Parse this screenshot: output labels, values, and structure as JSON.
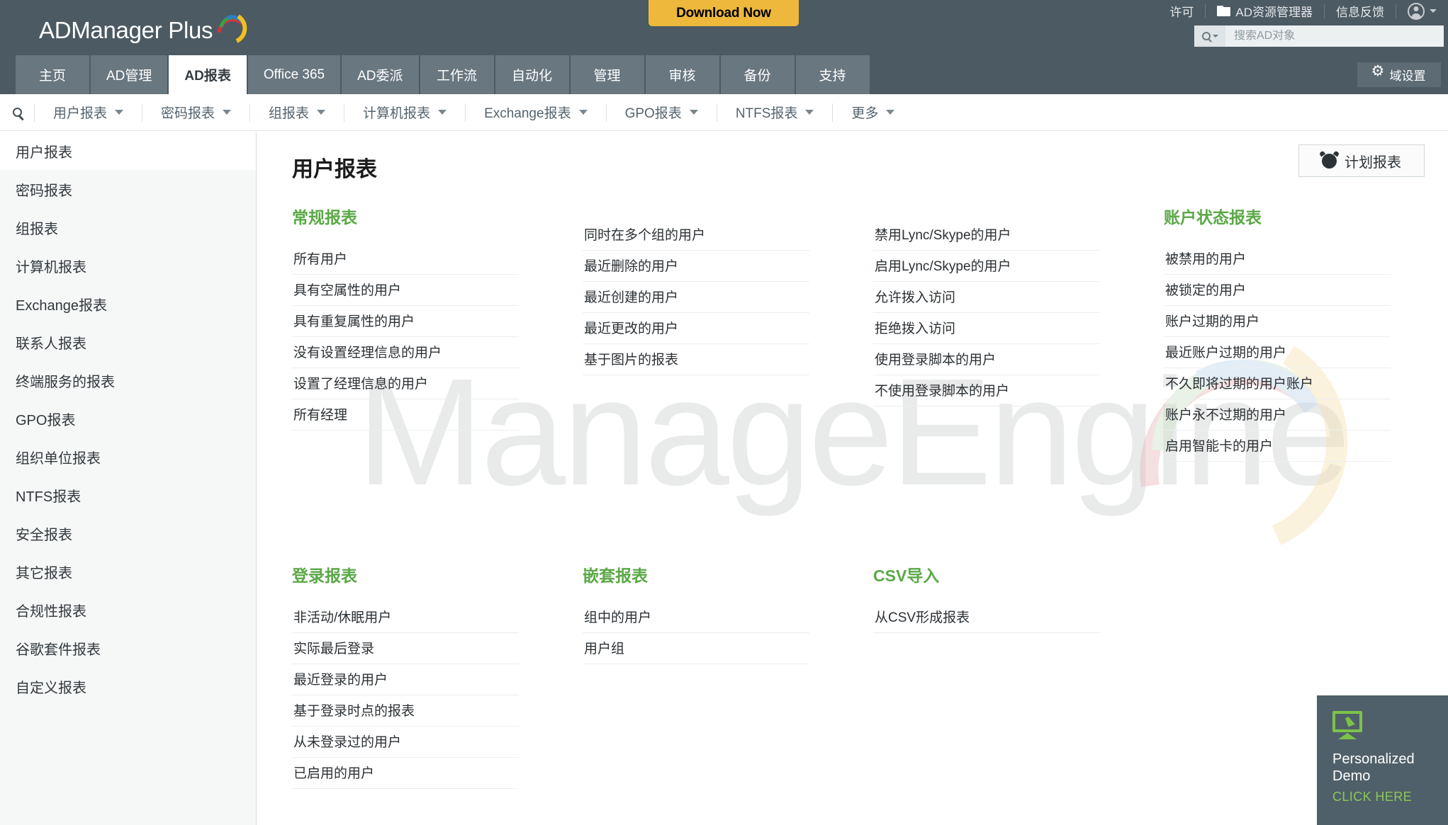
{
  "brand": {
    "name": "ADManager Plus",
    "accent_green": "#5aa846",
    "header_bg": "#4b5a63",
    "download_bg": "#edb83c"
  },
  "topbar": {
    "download_label": "Download Now",
    "license_label": "许可",
    "ad_explorer_label": "AD资源管理器",
    "feedback_label": "信息反馈",
    "search_placeholder": "搜索AD对象"
  },
  "nav": {
    "tabs": [
      {
        "label": "主页",
        "active": false
      },
      {
        "label": "AD管理",
        "active": false
      },
      {
        "label": "AD报表",
        "active": true
      },
      {
        "label": "Office 365",
        "active": false
      },
      {
        "label": "AD委派",
        "active": false
      },
      {
        "label": "工作流",
        "active": false
      },
      {
        "label": "自动化",
        "active": false
      },
      {
        "label": "管理",
        "active": false
      },
      {
        "label": "审核",
        "active": false
      },
      {
        "label": "备份",
        "active": false
      },
      {
        "label": "支持",
        "active": false
      }
    ],
    "domain_settings_label": "域设置"
  },
  "subnav": {
    "items": [
      {
        "label": "用户报表"
      },
      {
        "label": "密码报表"
      },
      {
        "label": "组报表"
      },
      {
        "label": "计算机报表"
      },
      {
        "label": "Exchange报表"
      },
      {
        "label": "GPO报表"
      },
      {
        "label": "NTFS报表"
      },
      {
        "label": "更多"
      }
    ]
  },
  "sidebar": {
    "items": [
      {
        "label": "用户报表",
        "active": true
      },
      {
        "label": "密码报表",
        "active": false
      },
      {
        "label": "组报表",
        "active": false
      },
      {
        "label": "计算机报表",
        "active": false
      },
      {
        "label": "Exchange报表",
        "active": false
      },
      {
        "label": "联系人报表",
        "active": false
      },
      {
        "label": "终端服务的报表",
        "active": false
      },
      {
        "label": "GPO报表",
        "active": false
      },
      {
        "label": "组织单位报表",
        "active": false
      },
      {
        "label": "NTFS报表",
        "active": false
      },
      {
        "label": "安全报表",
        "active": false
      },
      {
        "label": "其它报表",
        "active": false
      },
      {
        "label": "合规性报表",
        "active": false
      },
      {
        "label": "谷歌套件报表",
        "active": false
      },
      {
        "label": "自定义报表",
        "active": false
      }
    ]
  },
  "main": {
    "page_title": "用户报表",
    "schedule_button_label": "计划报表",
    "watermark": "ManageEngine",
    "sections_row1": [
      {
        "title": "常规报表",
        "items": [
          "所有用户",
          "具有空属性的用户",
          "具有重复属性的用户",
          "没有设置经理信息的用户",
          "设置了经理信息的用户",
          "所有经理"
        ]
      },
      {
        "title": "",
        "items": [
          "同时在多个组的用户",
          "最近删除的用户",
          "最近创建的用户",
          "最近更改的用户",
          "基于图片的报表"
        ]
      },
      {
        "title": "",
        "items": [
          "禁用Lync/Skype的用户",
          "启用Lync/Skype的用户",
          "允许拨入访问",
          "拒绝拨入访问",
          "使用登录脚本的用户",
          "不使用登录脚本的用户"
        ]
      },
      {
        "title": "账户状态报表",
        "items": [
          "被禁用的用户",
          "被锁定的用户",
          "账户过期的用户",
          "最近账户过期的用户",
          "不久即将过期的用户账户",
          "账户永不过期的用户",
          "启用智能卡的用户"
        ]
      }
    ],
    "sections_row2": [
      {
        "title": "登录报表",
        "items": [
          "非活动/休眠用户",
          "实际最后登录",
          "最近登录的用户",
          "基于登录时点的报表",
          "从未登录过的用户",
          "已启用的用户"
        ]
      },
      {
        "title": "嵌套报表",
        "items": [
          "组中的用户",
          "用户组"
        ]
      },
      {
        "title": "CSV导入",
        "items": [
          "从CSV形成报表"
        ]
      },
      {
        "title": "",
        "items": []
      }
    ]
  },
  "demo_widget": {
    "title_line1": "Personalized",
    "title_line2": "Demo",
    "cta": "CLICK HERE"
  }
}
